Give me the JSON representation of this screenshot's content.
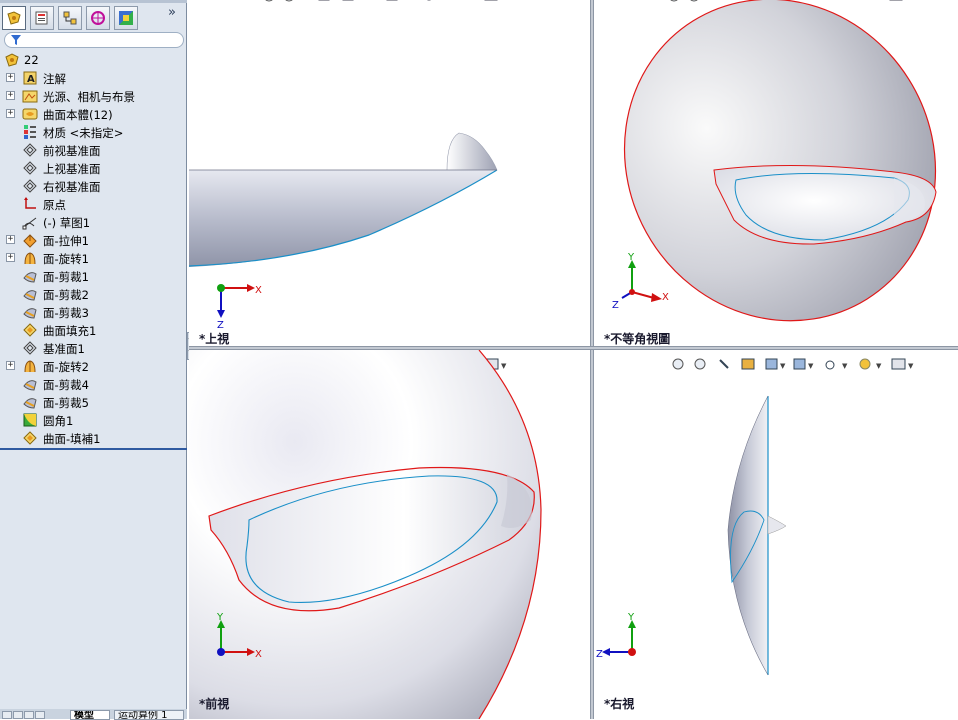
{
  "feature_tree": {
    "root": {
      "label": "22"
    },
    "items": [
      {
        "label": "注解",
        "icon": "annotations-icon",
        "expandable": true
      },
      {
        "label": "光源、相机与布景",
        "icon": "lights-cameras-scene-icon",
        "expandable": true
      },
      {
        "label": "曲面本體(12)",
        "icon": "surface-bodies-icon",
        "expandable": true
      },
      {
        "label": "材质 <未指定>",
        "icon": "material-icon",
        "expandable": false
      },
      {
        "label": "前视基准面",
        "icon": "plane-icon",
        "expandable": false
      },
      {
        "label": "上视基准面",
        "icon": "plane-icon",
        "expandable": false
      },
      {
        "label": "右视基准面",
        "icon": "plane-icon",
        "expandable": false
      },
      {
        "label": "原点",
        "icon": "origin-icon",
        "expandable": false
      },
      {
        "label": "(-) 草图1",
        "icon": "sketch-icon",
        "expandable": false
      },
      {
        "label": "面-拉伸1",
        "icon": "surface-extrude-icon",
        "expandable": true
      },
      {
        "label": "面-旋转1",
        "icon": "surface-revolve-icon",
        "expandable": true
      },
      {
        "label": "面-剪裁1",
        "icon": "surface-trim-icon",
        "expandable": false
      },
      {
        "label": "面-剪裁2",
        "icon": "surface-trim-icon",
        "expandable": false
      },
      {
        "label": "面-剪裁3",
        "icon": "surface-trim-icon",
        "expandable": false
      },
      {
        "label": "曲面填充1",
        "icon": "surface-fill-icon",
        "expandable": false
      },
      {
        "label": "基准面1",
        "icon": "plane-icon",
        "expandable": false
      },
      {
        "label": "面-旋转2",
        "icon": "surface-revolve-icon",
        "expandable": true
      },
      {
        "label": "面-剪裁4",
        "icon": "surface-trim-icon",
        "expandable": false
      },
      {
        "label": "面-剪裁5",
        "icon": "surface-trim-icon",
        "expandable": false
      },
      {
        "label": "圆角1",
        "icon": "fillet-icon",
        "expandable": false
      },
      {
        "label": "曲面-填補1",
        "icon": "surface-fill-icon",
        "expandable": false
      }
    ],
    "more_glyph": "»"
  },
  "bottom_tabs": [
    {
      "label": "模型",
      "active": true
    },
    {
      "label": "运动算例 1",
      "active": false
    }
  ],
  "viewports": {
    "top": {
      "label": "*上視"
    },
    "iso": {
      "label": "*不等角視圖"
    },
    "front": {
      "label": "*前視"
    },
    "right": {
      "label": "*右視"
    }
  },
  "axes": {
    "x": "X",
    "y": "Y",
    "z": "Z"
  },
  "colors": {
    "edge_red": "#e01818",
    "edge_blue": "#1a8fc8",
    "axis_x": "#d01010",
    "axis_y": "#10a010",
    "axis_z": "#1010c0",
    "selection_blue": "#2f5aa0"
  }
}
